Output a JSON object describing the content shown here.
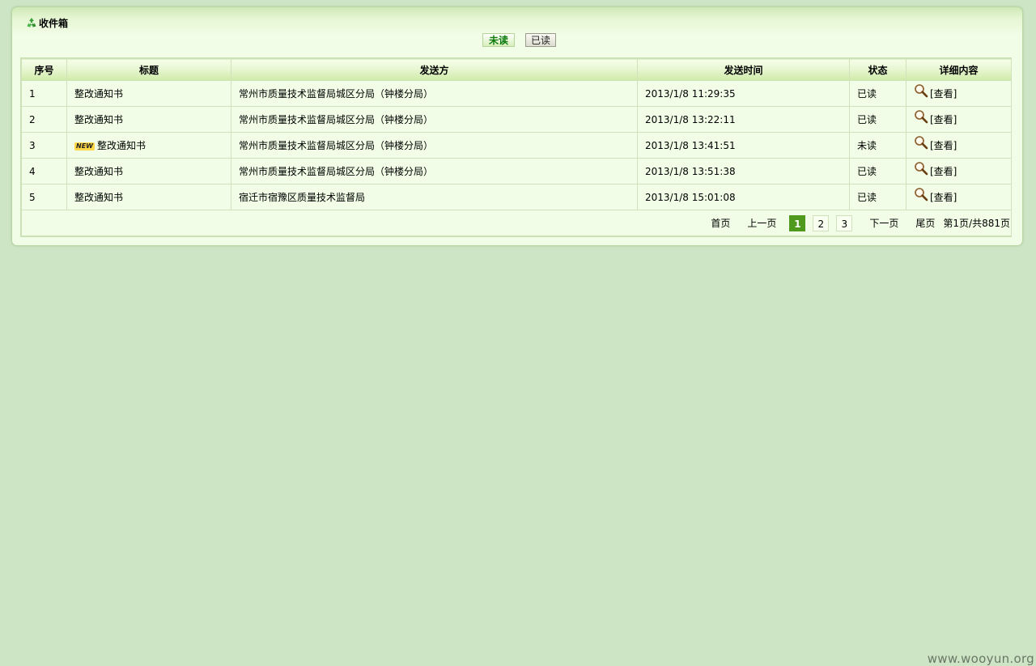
{
  "panel": {
    "title": "收件箱",
    "title_icon": "recycle-icon"
  },
  "filters": {
    "unread_label": "未读",
    "read_label": "已读",
    "active": "未读"
  },
  "table": {
    "headers": [
      "序号",
      "标题",
      "发送方",
      "发送时间",
      "状态",
      "详细内容"
    ],
    "rows": [
      {
        "index": "1",
        "new": false,
        "title": "整改通知书",
        "sender": "常州市质量技术监督局城区分局（钟楼分局）",
        "time": "2013/1/8 11:29:35",
        "status": "已读",
        "action": "[查看]"
      },
      {
        "index": "2",
        "new": false,
        "title": "整改通知书",
        "sender": "常州市质量技术监督局城区分局（钟楼分局）",
        "time": "2013/1/8 13:22:11",
        "status": "已读",
        "action": "[查看]"
      },
      {
        "index": "3",
        "new": true,
        "title": "整改通知书",
        "sender": "常州市质量技术监督局城区分局（钟楼分局）",
        "time": "2013/1/8 13:41:51",
        "status": "未读",
        "action": "[查看]"
      },
      {
        "index": "4",
        "new": false,
        "title": "整改通知书",
        "sender": "常州市质量技术监督局城区分局（钟楼分局）",
        "time": "2013/1/8 13:51:38",
        "status": "已读",
        "action": "[查看]"
      },
      {
        "index": "5",
        "new": false,
        "title": "整改通知书",
        "sender": "宿迁市宿豫区质量技术监督局",
        "time": "2013/1/8 15:01:08",
        "status": "已读",
        "action": "[查看]"
      }
    ],
    "new_badge": "NEW",
    "action_icon": "magnifier-icon"
  },
  "pager": {
    "first": "首页",
    "prev": "上一页",
    "pages": [
      "1",
      "2",
      "3"
    ],
    "current": "1",
    "next": "下一页",
    "last": "尾页",
    "info": "第1页/共881页"
  },
  "watermark": "www.wooyun.org",
  "colors": {
    "background": "#cde5c4",
    "panel": "#f1fde6",
    "active_tab_text": "#0d7c0d",
    "current_page": "#4f9a1d"
  }
}
